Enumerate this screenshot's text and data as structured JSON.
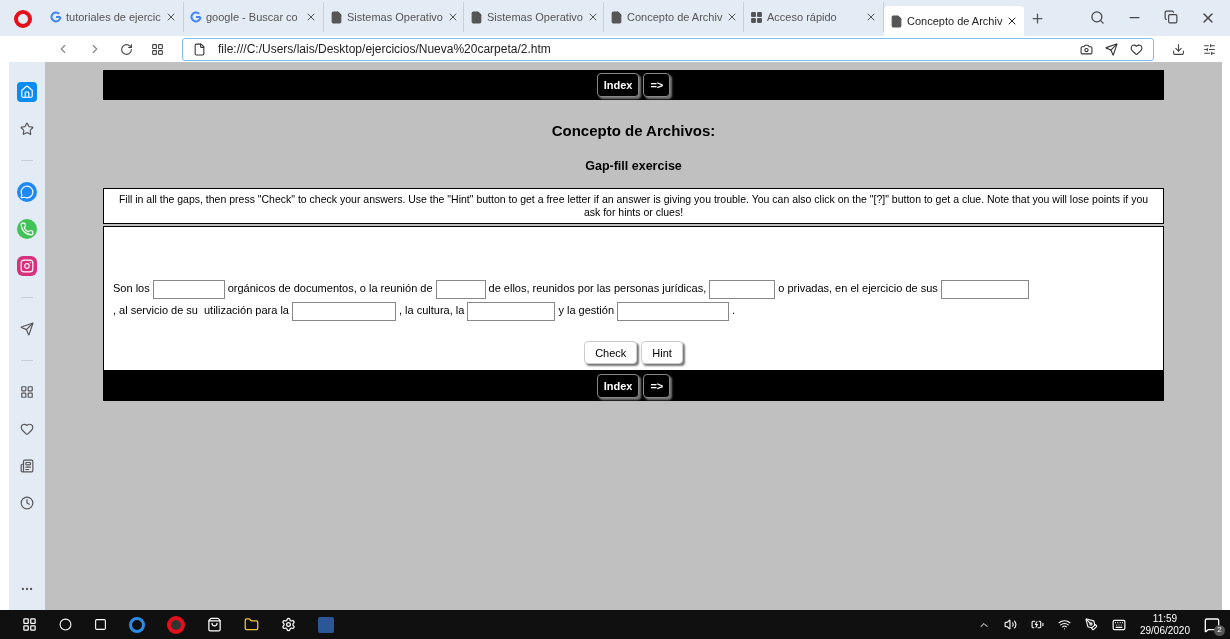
{
  "tabs": [
    {
      "kind": "google",
      "title": "tutoriales de ejercic",
      "selected": false
    },
    {
      "kind": "google",
      "title": "google - Buscar co",
      "selected": false
    },
    {
      "kind": "page",
      "title": "Sistemas Operativo",
      "selected": false
    },
    {
      "kind": "page",
      "title": "Sistemas Operativo",
      "selected": false
    },
    {
      "kind": "page",
      "title": "Concepto de Archiv",
      "selected": false
    },
    {
      "kind": "grid",
      "title": "Acceso rápido",
      "selected": false
    },
    {
      "kind": "page",
      "title": "Concepto de Archiv",
      "selected": true
    }
  ],
  "address": {
    "value": "file:///C:/Users/lais/Desktop/ejercicios/Nueva%20carpeta/2.htm"
  },
  "sidebar": [
    {
      "kind": "home",
      "selected": true
    },
    {
      "kind": "star",
      "selected": false
    },
    {
      "kind": "sep"
    },
    {
      "kind": "messenger",
      "selected": false
    },
    {
      "kind": "whatsapp",
      "selected": false
    },
    {
      "kind": "instagram",
      "selected": false
    },
    {
      "kind": "sep"
    },
    {
      "kind": "send",
      "selected": false
    },
    {
      "kind": "sep"
    },
    {
      "kind": "grid",
      "selected": false
    },
    {
      "kind": "heart",
      "selected": false
    },
    {
      "kind": "news",
      "selected": false
    },
    {
      "kind": "history",
      "selected": false
    }
  ],
  "nav_top": [
    "Index",
    "=>"
  ],
  "page": {
    "title": "Concepto de Archivos:",
    "subtitle": "Gap-fill exercise",
    "instructions": "Fill in all the gaps, then press \"Check\" to check your answers. Use the \"Hint\" button to get a free letter if an answer is giving you trouble. You can also click on the \"[?]\" button to get a clue. Note that you will lose points if you ask for hints or clues!",
    "segments": [
      {
        "kind": "text",
        "text": "Son los"
      },
      {
        "kind": "gap"
      },
      {
        "kind": "text",
        "text": "orgánicos de documentos, o la reunión de"
      },
      {
        "kind": "gap"
      },
      {
        "kind": "text",
        "text": "de ellos, reunidos por las personas jurídicas,"
      },
      {
        "kind": "gap"
      },
      {
        "kind": "text",
        "text": "o privadas, en el ejercicio de sus"
      },
      {
        "kind": "gap"
      },
      {
        "kind": "text",
        "text": ", al servicio de su"
      },
      {
        "kind": "text",
        "text": "utilización para la"
      },
      {
        "kind": "gap"
      },
      {
        "kind": "text",
        "text": ", la cultura, la"
      },
      {
        "kind": "gap"
      },
      {
        "kind": "text",
        "text": "y la gestión"
      },
      {
        "kind": "gap"
      },
      {
        "kind": "text",
        "text": "."
      }
    ],
    "buttons": [
      "Check",
      "Hint"
    ]
  },
  "nav_bottom": [
    "Index",
    "=>"
  ],
  "taskbar": {
    "time": "11:59",
    "date": "29/06/2020",
    "notifications": "2"
  }
}
